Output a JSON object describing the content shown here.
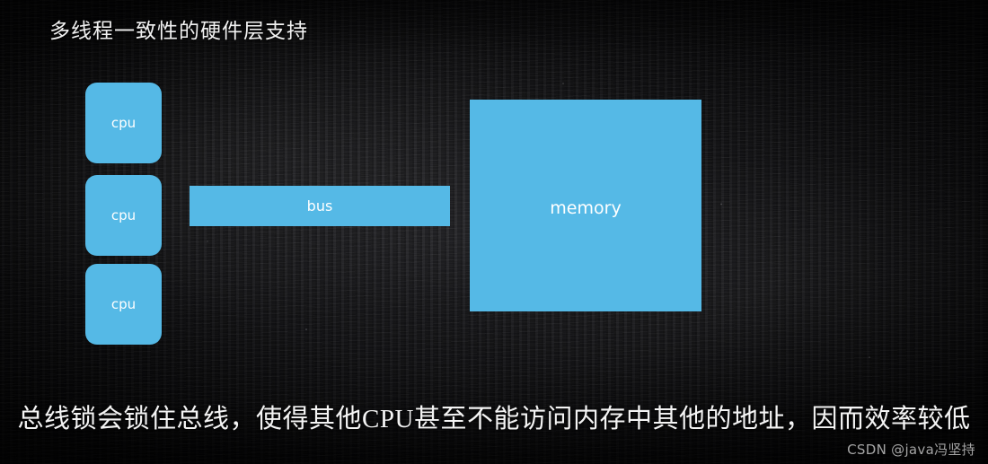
{
  "slide": {
    "title": "多线程一致性的硬件层支持",
    "caption": "总线锁会锁住总线，使得其他CPU甚至不能访问内存中其他的地址，因而效率较低",
    "watermark": "CSDN @java冯坚持"
  },
  "theme": {
    "board_background": "#131313",
    "node_fill": "#55b9e6",
    "node_text": "#ffffff",
    "title_text": "#f2f2f2",
    "caption_text": "#f4f4f4"
  },
  "diagram": {
    "cpus": [
      {
        "label": "cpu"
      },
      {
        "label": "cpu"
      },
      {
        "label": "cpu"
      }
    ],
    "bus": {
      "label": "bus"
    },
    "memory": {
      "label": "memory"
    }
  }
}
